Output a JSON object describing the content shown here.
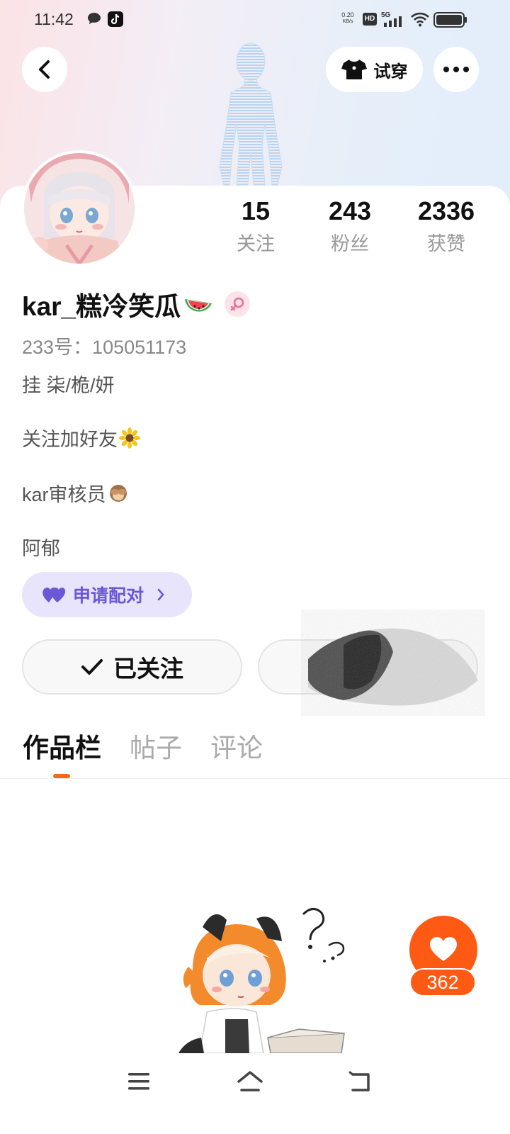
{
  "status_bar": {
    "time": "11:42",
    "speed_value": "0.20",
    "speed_unit": "KB/s",
    "hd": "HD",
    "network": "5G"
  },
  "header": {
    "tryon_label": "试穿"
  },
  "stats": {
    "following": {
      "value": "15",
      "label": "关注"
    },
    "fans": {
      "value": "243",
      "label": "粉丝"
    },
    "likes": {
      "value": "2336",
      "label": "获赞"
    }
  },
  "profile": {
    "username": "kar_糕冷笑瓜",
    "id_line": "233号：105051173",
    "bio": [
      "挂 柒/桅/妍",
      "关注加好友",
      "kar审核员",
      "阿郁"
    ]
  },
  "pair_button": {
    "label": "申请配对"
  },
  "follow_button": {
    "label": "已关注"
  },
  "tabs": [
    {
      "label": "作品栏",
      "active": true
    },
    {
      "label": "帖子",
      "active": false
    },
    {
      "label": "评论",
      "active": false
    }
  ],
  "like_fab": {
    "count": "362"
  },
  "colors": {
    "accent_orange": "#ff5a14",
    "tab_indicator": "#f26c1b",
    "pair_bg": "#e8e4fb",
    "pair_text": "#6a58d6"
  }
}
